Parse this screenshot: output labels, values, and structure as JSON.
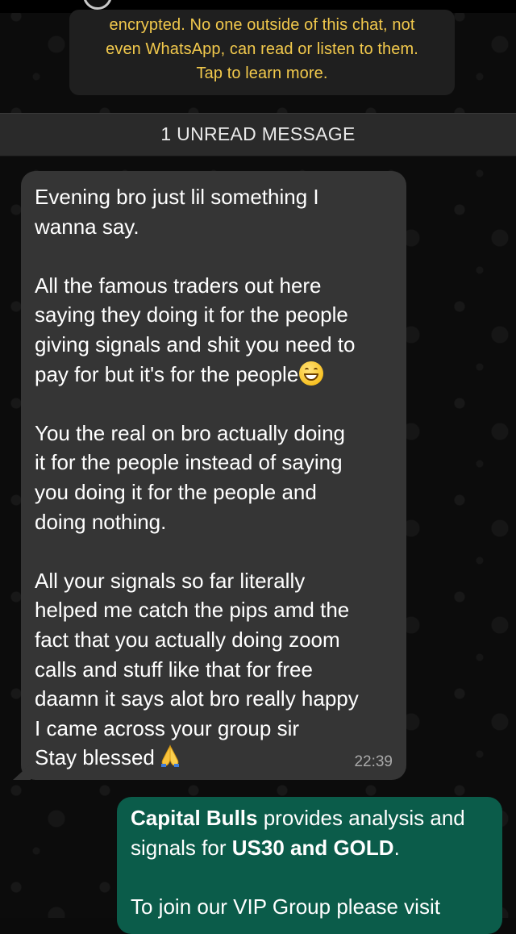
{
  "encryption_notice": {
    "lines": [
      "encrypted. No one outside of this chat, not",
      "even WhatsApp, can read or listen to them.",
      "Tap to learn more."
    ]
  },
  "unread_banner": "1 UNREAD MESSAGE",
  "incoming_message": {
    "lines": [
      "Evening bro just lil something  I",
      "wanna say.",
      "",
      "All the famous traders out here",
      "saying they doing it for the people",
      "giving signals and shit you need to",
      "pay for but it's for the people",
      "",
      "You the real on bro actually doing",
      "it for the people instead of saying",
      "you doing it for the people and",
      "doing nothing.",
      "",
      "All your signals so far literally",
      "helped me catch the pips amd the",
      "fact that you actually doing zoom",
      "calls and stuff like that for free",
      "daamn it says alot bro really happy",
      "I came across your group sir",
      "Stay blessed"
    ],
    "emoji_after_line_7": "grinning-face-emoji",
    "emoji_after_line_20": "folded-hands-emoji",
    "time": "22:39"
  },
  "outgoing_message": {
    "line1_bold": "Capital Bulls",
    "line1_rest": " provides analysis and",
    "line2_start": "signals for ",
    "line2_bold": "US30 and GOLD",
    "line2_end": ".",
    "line4": "To join our VIP Group please visit"
  },
  "colors": {
    "notice_text": "#f2c94c",
    "incoming_bubble": "#353535",
    "outgoing_bubble": "#0b5c4a",
    "timestamp": "#a9a9a9"
  }
}
